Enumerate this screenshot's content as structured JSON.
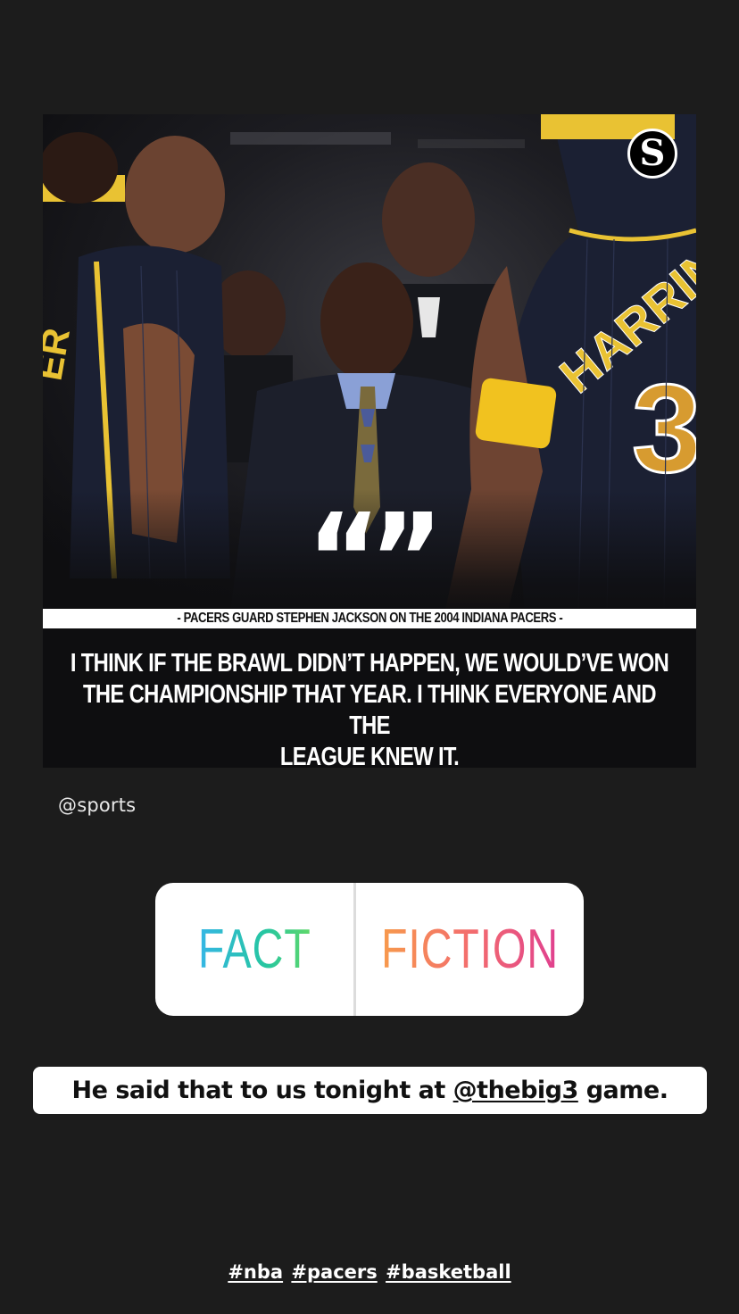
{
  "post": {
    "logo_letter": "S",
    "quote_mark": "“”",
    "attribution": "- PACERS GUARD STEPHEN JACKSON ON THE 2004 INDIANA PACERS -",
    "quote_lines": [
      "I THINK IF THE BRAWL DIDN’T HAPPEN, WE WOULD’VE WON",
      "THE CHAMPIONSHIP THAT YEAR. I THINK EVERYONE AND THE",
      "LEAGUE KNEW IT."
    ],
    "source_handle": "@sports"
  },
  "poll": {
    "option_1": "FACT",
    "option_2": "FICTION"
  },
  "caption": {
    "prefix": "He said that to us tonight at ",
    "mention": "@thebig3",
    "suffix": " game."
  },
  "hashtags": [
    "#nba",
    "#pacers",
    "#basketball"
  ],
  "colors": {
    "background": "#1c1c1c",
    "fact_gradient": [
      "#35b6e6",
      "#5fd86a"
    ],
    "fiction_gradient": [
      "#f79a4c",
      "#e0408f"
    ],
    "jersey_navy": "#1b2033",
    "jersey_gold": "#e9c233"
  }
}
